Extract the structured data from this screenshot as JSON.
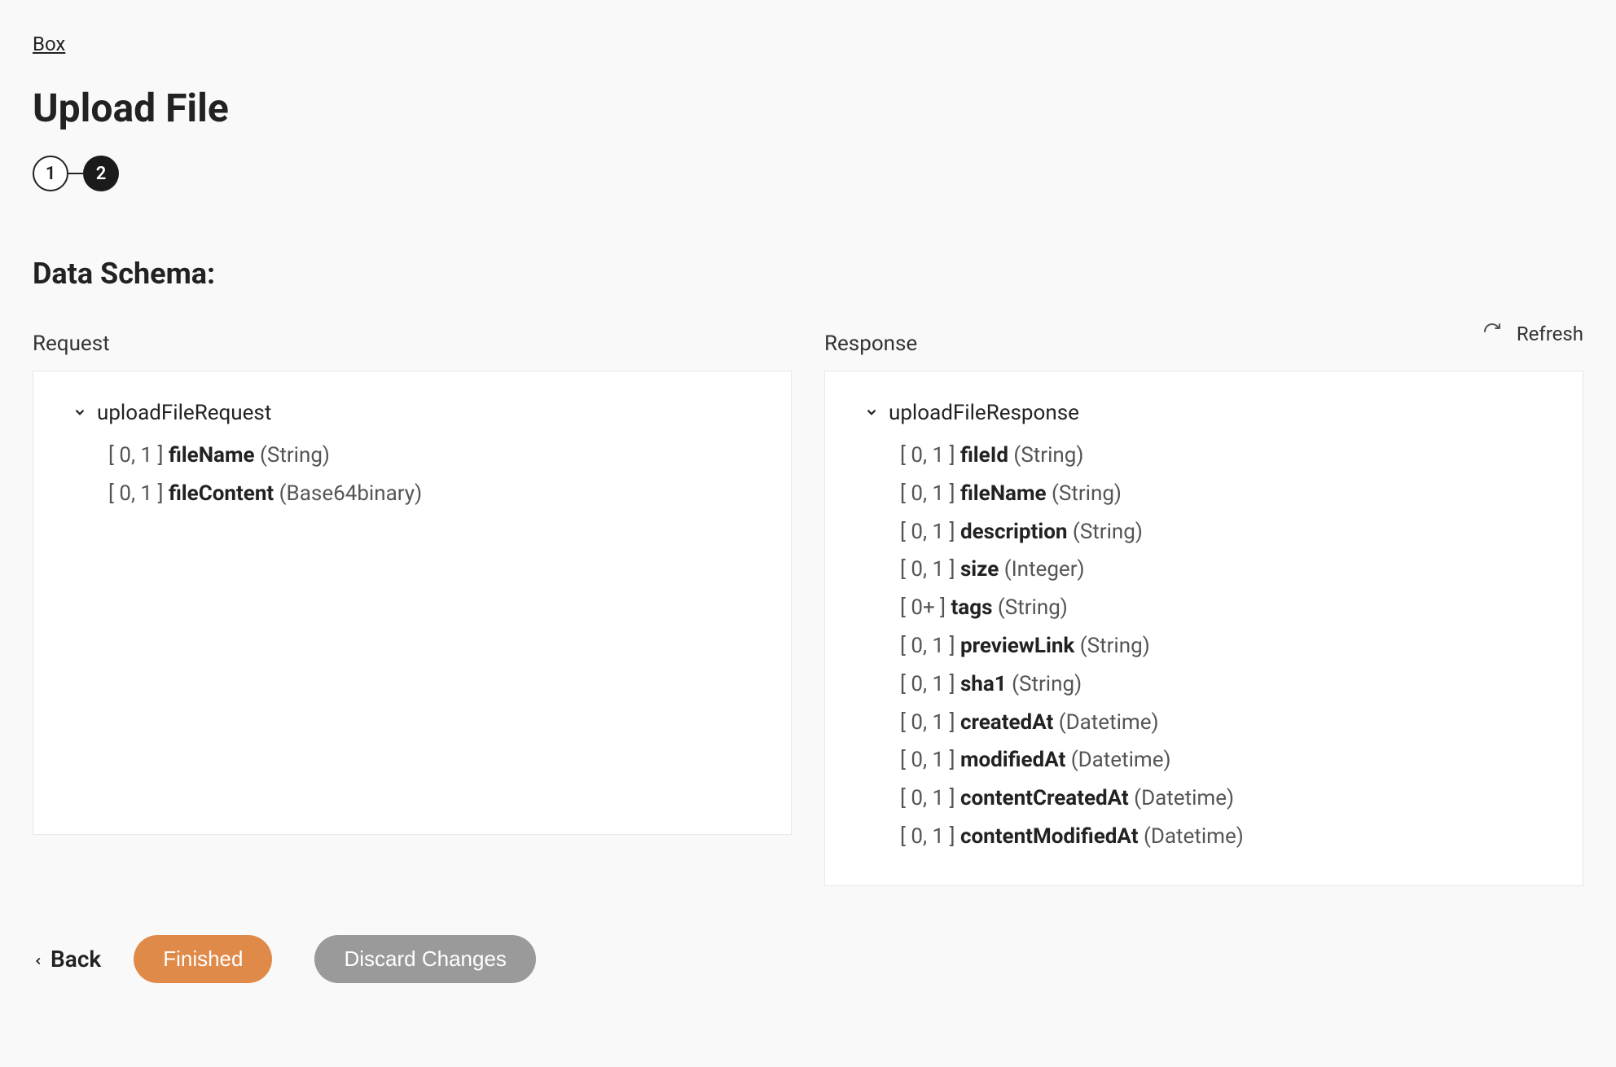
{
  "breadcrumb": {
    "label": "Box"
  },
  "page": {
    "title": "Upload File"
  },
  "stepper": {
    "step1": "1",
    "step2": "2"
  },
  "section": {
    "title": "Data Schema:"
  },
  "refresh": {
    "label": "Refresh"
  },
  "columns": {
    "request": {
      "heading": "Request",
      "root": "uploadFileRequest",
      "fields": [
        {
          "card": "[ 0, 1 ]",
          "name": "fileName",
          "type": "(String)"
        },
        {
          "card": "[ 0, 1 ]",
          "name": "fileContent",
          "type": "(Base64binary)"
        }
      ]
    },
    "response": {
      "heading": "Response",
      "root": "uploadFileResponse",
      "fields": [
        {
          "card": "[ 0, 1 ]",
          "name": "fileId",
          "type": "(String)"
        },
        {
          "card": "[ 0, 1 ]",
          "name": "fileName",
          "type": "(String)"
        },
        {
          "card": "[ 0, 1 ]",
          "name": "description",
          "type": "(String)"
        },
        {
          "card": "[ 0, 1 ]",
          "name": "size",
          "type": "(Integer)"
        },
        {
          "card": "[ 0+ ]",
          "name": "tags",
          "type": "(String)"
        },
        {
          "card": "[ 0, 1 ]",
          "name": "previewLink",
          "type": "(String)"
        },
        {
          "card": "[ 0, 1 ]",
          "name": "sha1",
          "type": "(String)"
        },
        {
          "card": "[ 0, 1 ]",
          "name": "createdAt",
          "type": "(Datetime)"
        },
        {
          "card": "[ 0, 1 ]",
          "name": "modifiedAt",
          "type": "(Datetime)"
        },
        {
          "card": "[ 0, 1 ]",
          "name": "contentCreatedAt",
          "type": "(Datetime)"
        },
        {
          "card": "[ 0, 1 ]",
          "name": "contentModifiedAt",
          "type": "(Datetime)"
        }
      ]
    }
  },
  "footer": {
    "back": "Back",
    "finished": "Finished",
    "discard": "Discard Changes"
  }
}
